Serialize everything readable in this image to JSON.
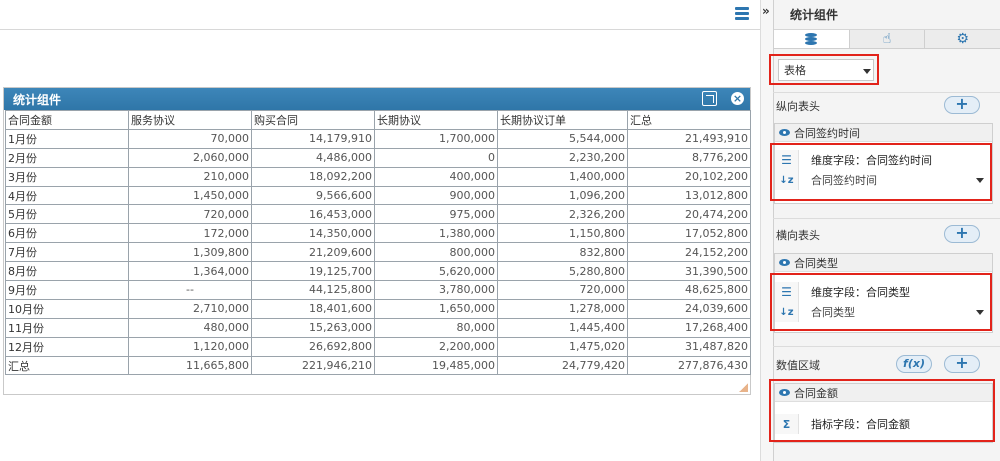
{
  "widget": {
    "title": "统计组件",
    "columns": [
      "合同金额",
      "服务协议",
      "购买合同",
      "长期协议",
      "长期协议订单",
      "汇总"
    ],
    "rows": [
      [
        "1月份",
        "70,000",
        "14,179,910",
        "1,700,000",
        "5,544,000",
        "21,493,910"
      ],
      [
        "2月份",
        "2,060,000",
        "4,486,000",
        "0",
        "2,230,200",
        "8,776,200"
      ],
      [
        "3月份",
        "210,000",
        "18,092,200",
        "400,000",
        "1,400,000",
        "20,102,200"
      ],
      [
        "4月份",
        "1,450,000",
        "9,566,600",
        "900,000",
        "1,096,200",
        "13,012,800"
      ],
      [
        "5月份",
        "720,000",
        "16,453,000",
        "975,000",
        "2,326,200",
        "20,474,200"
      ],
      [
        "6月份",
        "172,000",
        "14,350,000",
        "1,380,000",
        "1,150,800",
        "17,052,800"
      ],
      [
        "7月份",
        "1,309,800",
        "21,209,600",
        "800,000",
        "832,800",
        "24,152,200"
      ],
      [
        "8月份",
        "1,364,000",
        "19,125,700",
        "5,620,000",
        "5,280,800",
        "31,390,500"
      ],
      [
        "9月份",
        "--",
        "44,125,800",
        "3,780,000",
        "720,000",
        "48,625,800"
      ],
      [
        "10月份",
        "2,710,000",
        "18,401,600",
        "1,650,000",
        "1,278,000",
        "24,039,600"
      ],
      [
        "11月份",
        "480,000",
        "15,263,000",
        "80,000",
        "1,445,400",
        "17,268,400"
      ],
      [
        "12月份",
        "1,120,000",
        "26,692,800",
        "2,200,000",
        "1,475,020",
        "31,487,820"
      ],
      [
        "汇总",
        "11,665,800",
        "221,946,210",
        "19,485,000",
        "24,779,420",
        "277,876,430"
      ]
    ]
  },
  "panel": {
    "title": "统计组件",
    "collapse_glyph": "»",
    "component_type": "表格",
    "vertical_header": {
      "label": "纵向表头",
      "field_name": "合同签约时间",
      "dimension_text": "维度字段：合同签约时间",
      "sort_value": "合同签约时间"
    },
    "horizontal_header": {
      "label": "横向表头",
      "field_name": "合同类型",
      "dimension_text": "维度字段：合同类型",
      "sort_value": "合同类型"
    },
    "value_area": {
      "label": "数值区域",
      "fx_label": "f(x)",
      "field_name": "合同金额",
      "indicator_text": "指标字段：合同金额"
    },
    "plus": "+"
  },
  "icons": {
    "menu": "hamburger-icon",
    "database": "database-icon",
    "interaction": "hand-pointer-icon",
    "settings": "gear-icon"
  },
  "colors": {
    "header_blue": "#2f76a8",
    "accent": "#2d76b0",
    "highlight_red": "#e2231a"
  }
}
